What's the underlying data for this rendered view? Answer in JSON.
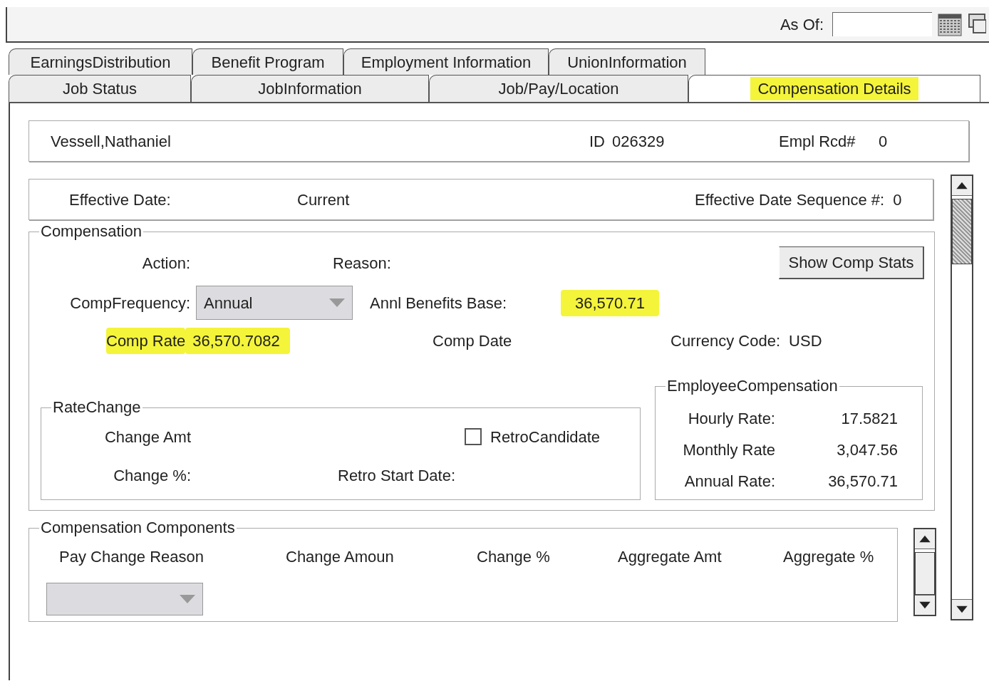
{
  "header": {
    "as_of_label": "As Of:"
  },
  "tabs_back": [
    {
      "label": "EarningsDistribution",
      "selected": false
    },
    {
      "label": "Benefit Program",
      "selected": false
    },
    {
      "label": "Employment Information",
      "selected": false
    },
    {
      "label": "UnionInformation",
      "selected": false
    }
  ],
  "tabs_front": [
    {
      "label": "Job Status",
      "selected": false,
      "highlighted": false
    },
    {
      "label": "JobInformation",
      "selected": false,
      "highlighted": false
    },
    {
      "label": "Job/Pay/Location",
      "selected": false,
      "highlighted": false
    },
    {
      "label": "Compensation Details",
      "selected": true,
      "highlighted": true
    }
  ],
  "employee": {
    "name": "Vessell,Nathaniel",
    "id_label": "ID",
    "id": "026329",
    "rcd_label": "Empl Rcd#",
    "rcd": "0"
  },
  "effective": {
    "date_label": "Effective Date:",
    "date_value": "Current",
    "seq_label": "Effective Date Sequence #:",
    "seq": "0"
  },
  "compensation": {
    "legend": "Compensation",
    "action_label": "Action:",
    "reason_label": "Reason:",
    "stats_button": "Show Comp Stats",
    "freq_label": "CompFrequency:",
    "freq_value": "Annual",
    "benefits_label": "Annl Benefits Base:",
    "benefits_value": "36,570.71",
    "benefits_highlighted": true,
    "rate_label": "Comp Rate",
    "rate_value": "36,570.7082",
    "rate_highlighted": true,
    "comp_date_label": "Comp Date",
    "currency_label": "Currency Code:",
    "currency": "USD"
  },
  "rate_change": {
    "legend": "RateChange",
    "change_amt_label": "Change Amt",
    "retro_label": "RetroCandidate",
    "retro_checked": false,
    "change_pct_label": "Change %:",
    "retro_start_label": "Retro Start Date:"
  },
  "employee_comp": {
    "legend": "EmployeeCompensation",
    "rows": [
      {
        "label": "Hourly Rate:",
        "value": "17.5821"
      },
      {
        "label": "Monthly Rate",
        "value": "3,047.56"
      },
      {
        "label": "Annual Rate:",
        "value": "36,570.71"
      }
    ]
  },
  "components": {
    "legend": "Compensation Components",
    "columns": [
      "Pay Change Reason",
      "Change Amoun",
      "Change %",
      "Aggregate Amt",
      "Aggregate %"
    ]
  }
}
